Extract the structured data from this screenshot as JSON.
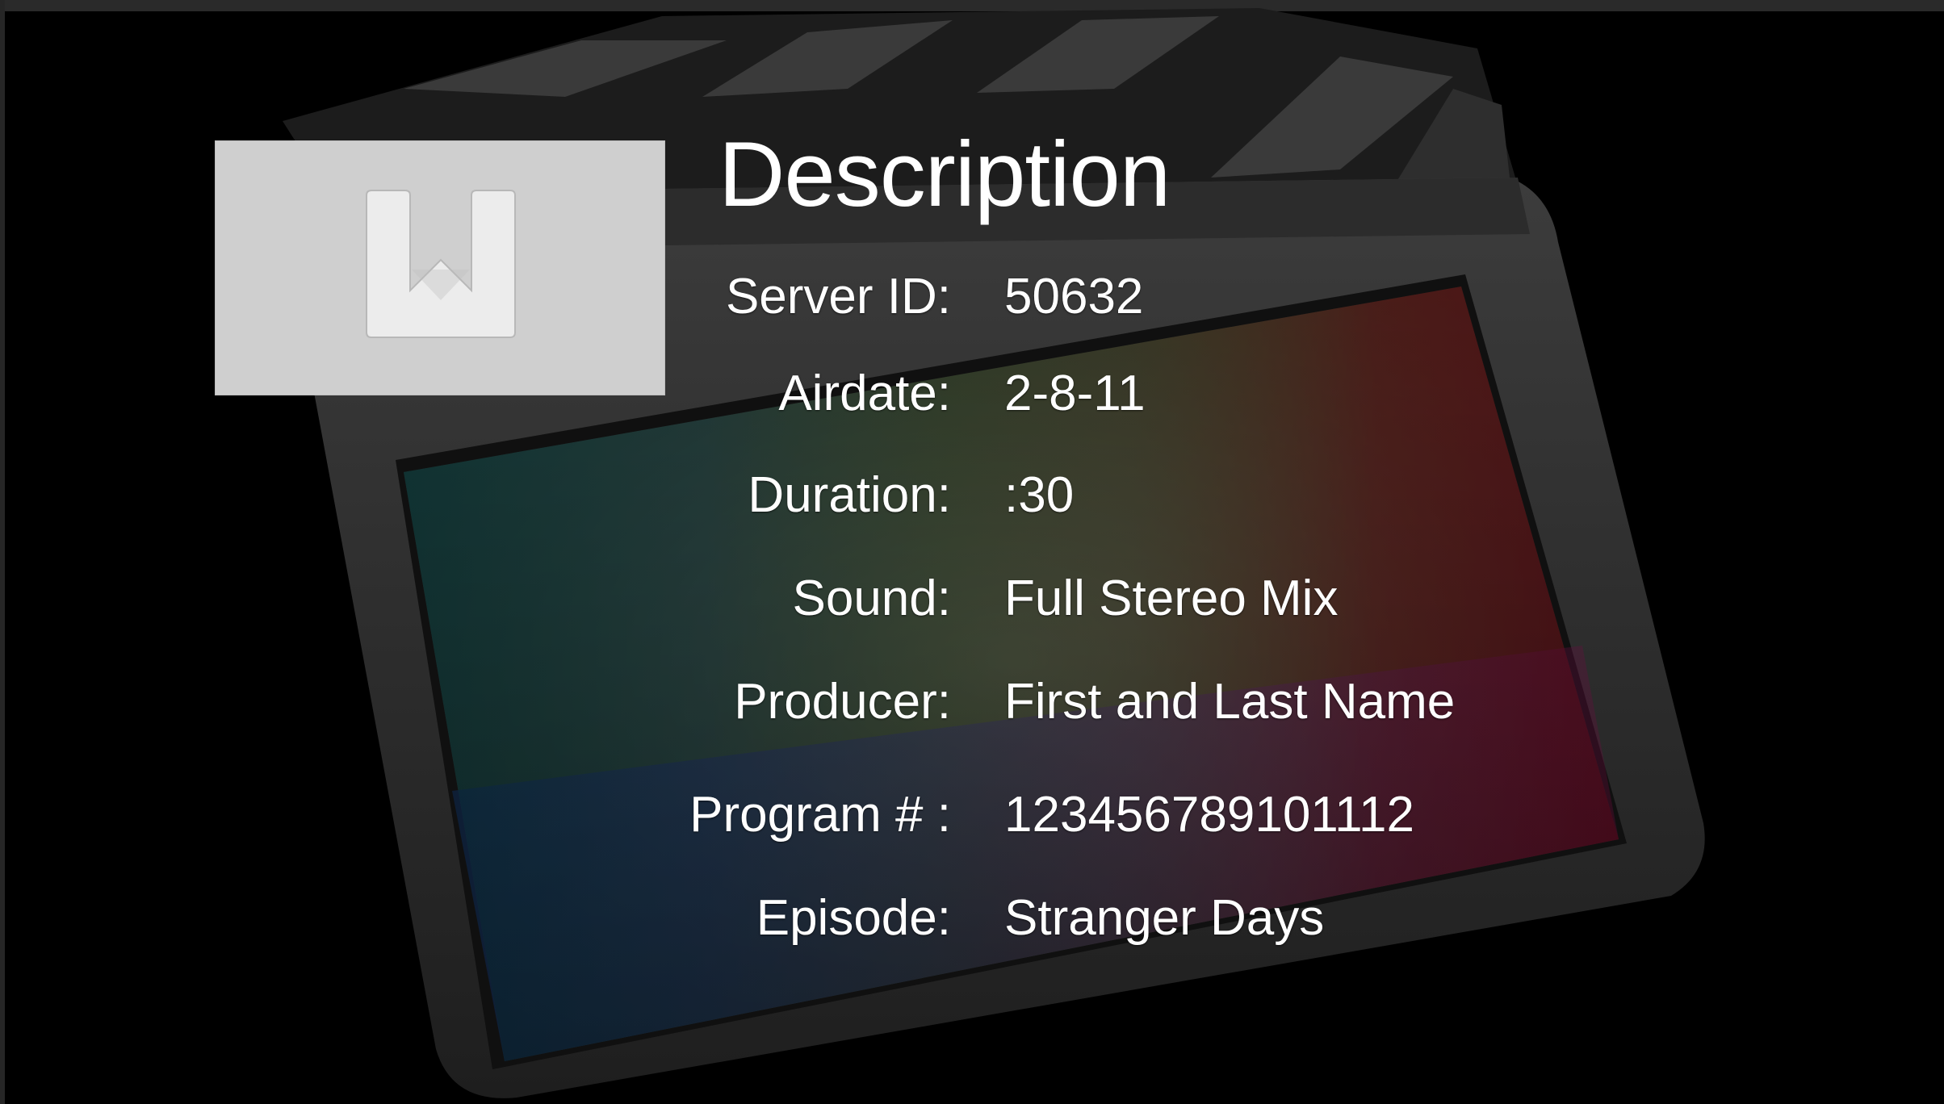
{
  "panel": {
    "title": "Description",
    "thumbnail_icon": "download-arrow-icon",
    "fields": [
      {
        "label": "Server ID:",
        "value": "50632"
      },
      {
        "label": "Airdate:",
        "value": "2-8-11"
      },
      {
        "label": "Duration:",
        "value": ":30"
      },
      {
        "label": "Sound:",
        "value": "Full Stereo Mix"
      },
      {
        "label": "Producer:",
        "value": "First and Last Name"
      },
      {
        "label": "Program # :",
        "value": "123456789101112"
      },
      {
        "label": "Episode:",
        "value": "Stranger Days"
      }
    ]
  },
  "colors": {
    "background": "#000000",
    "thumbnail": "#cfcfcf",
    "text": "#ffffff"
  }
}
